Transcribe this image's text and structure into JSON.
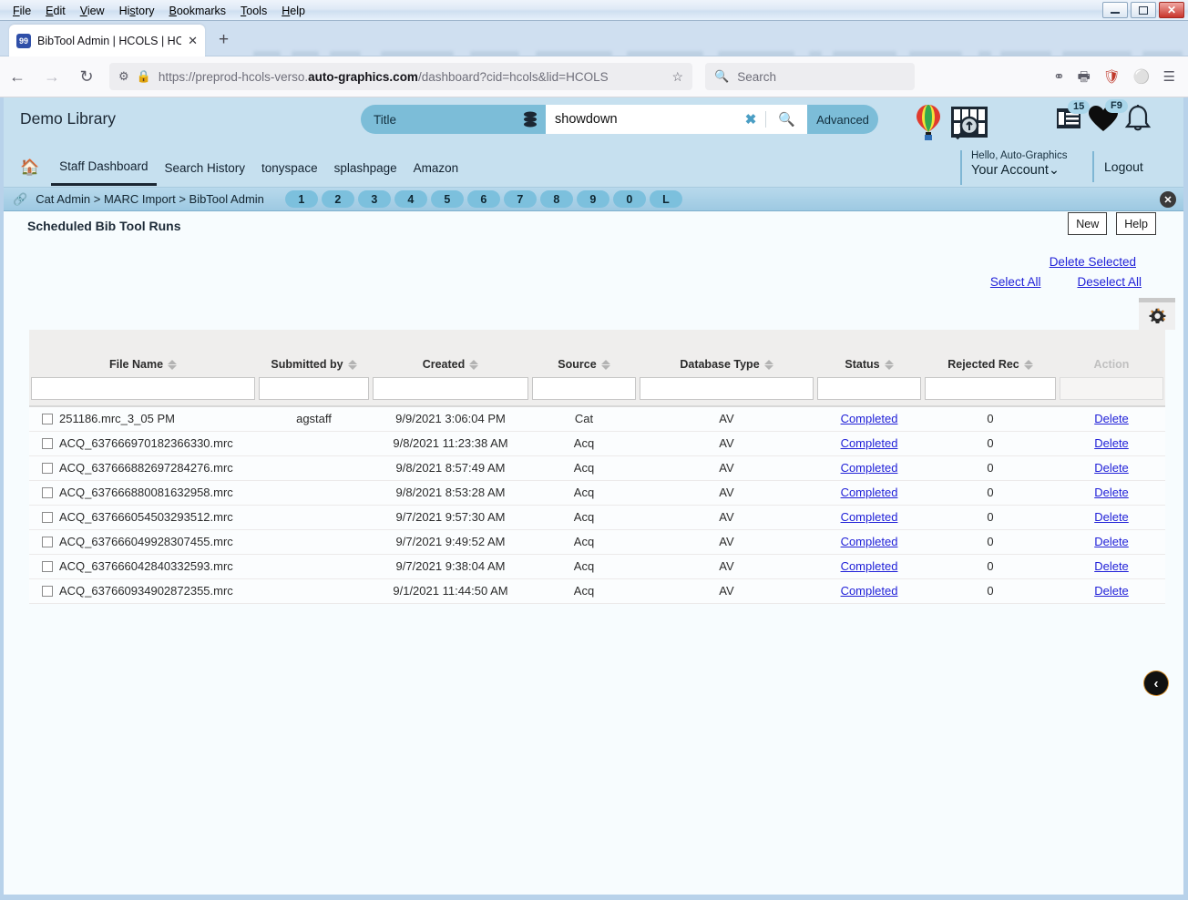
{
  "window": {
    "menus": [
      "File",
      "Edit",
      "View",
      "History",
      "Bookmarks",
      "Tools",
      "Help"
    ],
    "minimize_label": "–",
    "maximize_label": "□",
    "close_label": "✕"
  },
  "browser": {
    "tab_title": "BibTool Admin | HCOLS | HCOL",
    "tab_favicon_text": "99",
    "tab_close": "✕",
    "new_tab": "+",
    "back": "←",
    "forward": "→",
    "reload": "↻",
    "url_prefix": "https://preprod-hcols-verso.",
    "url_domain": "auto-graphics.com",
    "url_suffix": "/dashboard?cid=hcols&lid=HCOLS",
    "bookmark_star": "☆",
    "search_placeholder": "Search"
  },
  "app_header": {
    "library_name": "Demo Library",
    "scope_selected": "Title",
    "scope_caret": "⌄",
    "query": "showdown",
    "clear_label": "✖",
    "advanced_label": "Advanced",
    "list_badge": "15",
    "heart_badge": "F9",
    "hello_text": "Hello, Auto-Graphics",
    "account_label": "Your Account",
    "account_caret": "⌄",
    "logout_label": "Logout"
  },
  "app_nav": {
    "items": [
      {
        "label": "Staff Dashboard",
        "active": true
      },
      {
        "label": "Search History",
        "active": false
      },
      {
        "label": "tonyspace",
        "active": false
      },
      {
        "label": "splashpage",
        "active": false
      },
      {
        "label": "Amazon",
        "active": false
      }
    ]
  },
  "breadcrumb": {
    "trail": "Cat Admin > MARC Import > BibTool Admin",
    "pills": [
      "1",
      "2",
      "3",
      "4",
      "5",
      "6",
      "7",
      "8",
      "9",
      "0",
      "L"
    ],
    "close_label": "✕"
  },
  "content": {
    "page_title": "Scheduled Bib Tool Runs",
    "new_label": "New",
    "help_label": "Help",
    "delete_selected_label": "Delete Selected",
    "select_all_label": "Select All",
    "deselect_all_label": "Deselect All",
    "gear_icon": "gear-icon",
    "back_arrow": "‹"
  },
  "table": {
    "columns": [
      {
        "key": "file_name",
        "label": "File Name",
        "sortable": true
      },
      {
        "key": "submitted_by",
        "label": "Submitted by",
        "sortable": true
      },
      {
        "key": "created",
        "label": "Created",
        "sortable": true
      },
      {
        "key": "source",
        "label": "Source",
        "sortable": true
      },
      {
        "key": "database_type",
        "label": "Database Type",
        "sortable": true
      },
      {
        "key": "status",
        "label": "Status",
        "sortable": true
      },
      {
        "key": "rejected_rec",
        "label": "Rejected Rec",
        "sortable": true
      },
      {
        "key": "action",
        "label": "Action",
        "sortable": false
      }
    ],
    "rows": [
      {
        "file_name": "251186.mrc_3_05 PM",
        "submitted_by": "agstaff",
        "created": "9/9/2021 3:06:04 PM",
        "source": "Cat",
        "database_type": "AV",
        "status": "Completed",
        "rejected_rec": "0",
        "action": "Delete",
        "checked": false
      },
      {
        "file_name": "ACQ_637666970182366330.mrc",
        "submitted_by": "",
        "created": "9/8/2021 11:23:38 AM",
        "source": "Acq",
        "database_type": "AV",
        "status": "Completed",
        "rejected_rec": "0",
        "action": "Delete",
        "checked": false
      },
      {
        "file_name": "ACQ_637666882697284276.mrc",
        "submitted_by": "",
        "created": "9/8/2021 8:57:49 AM",
        "source": "Acq",
        "database_type": "AV",
        "status": "Completed",
        "rejected_rec": "0",
        "action": "Delete",
        "checked": false
      },
      {
        "file_name": "ACQ_637666880081632958.mrc",
        "submitted_by": "",
        "created": "9/8/2021 8:53:28 AM",
        "source": "Acq",
        "database_type": "AV",
        "status": "Completed",
        "rejected_rec": "0",
        "action": "Delete",
        "checked": false
      },
      {
        "file_name": "ACQ_637666054503293512.mrc",
        "submitted_by": "",
        "created": "9/7/2021 9:57:30 AM",
        "source": "Acq",
        "database_type": "AV",
        "status": "Completed",
        "rejected_rec": "0",
        "action": "Delete",
        "checked": false
      },
      {
        "file_name": "ACQ_637666049928307455.mrc",
        "submitted_by": "",
        "created": "9/7/2021 9:49:52 AM",
        "source": "Acq",
        "database_type": "AV",
        "status": "Completed",
        "rejected_rec": "0",
        "action": "Delete",
        "checked": false
      },
      {
        "file_name": "ACQ_637666042840332593.mrc",
        "submitted_by": "",
        "created": "9/7/2021 9:38:04 AM",
        "source": "Acq",
        "database_type": "AV",
        "status": "Completed",
        "rejected_rec": "0",
        "action": "Delete",
        "checked": false
      },
      {
        "file_name": "ACQ_637660934902872355.mrc",
        "submitted_by": "",
        "created": "9/1/2021 11:44:50 AM",
        "source": "Acq",
        "database_type": "AV",
        "status": "Completed",
        "rejected_rec": "0",
        "action": "Delete",
        "checked": false
      }
    ]
  },
  "colors": {
    "header_blue": "#c6e0ef",
    "pill_blue": "#7cbdd8",
    "link_blue": "#2121d8",
    "breadcrumb_blue": "#9dc9e2"
  }
}
